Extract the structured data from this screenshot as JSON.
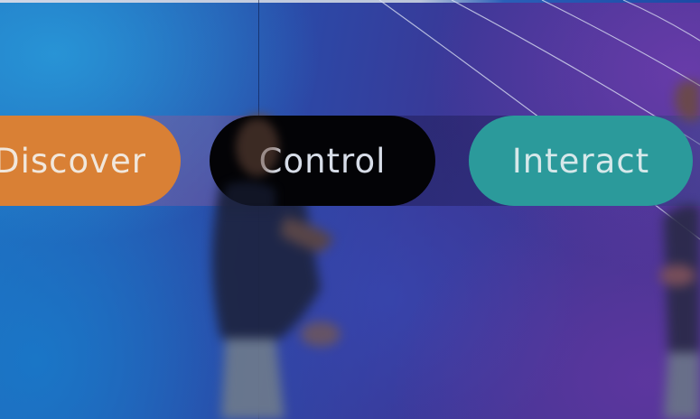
{
  "hero": {
    "pills": [
      {
        "label": "Discover",
        "color": "#d98035"
      },
      {
        "label": "Control",
        "color": "#030306"
      },
      {
        "label": "Interact",
        "color": "#2b9a9b"
      }
    ]
  },
  "colors": {
    "background_left": "#1f6fc0",
    "background_right": "#4a3390",
    "arc_lines": "#dfe6f5"
  }
}
